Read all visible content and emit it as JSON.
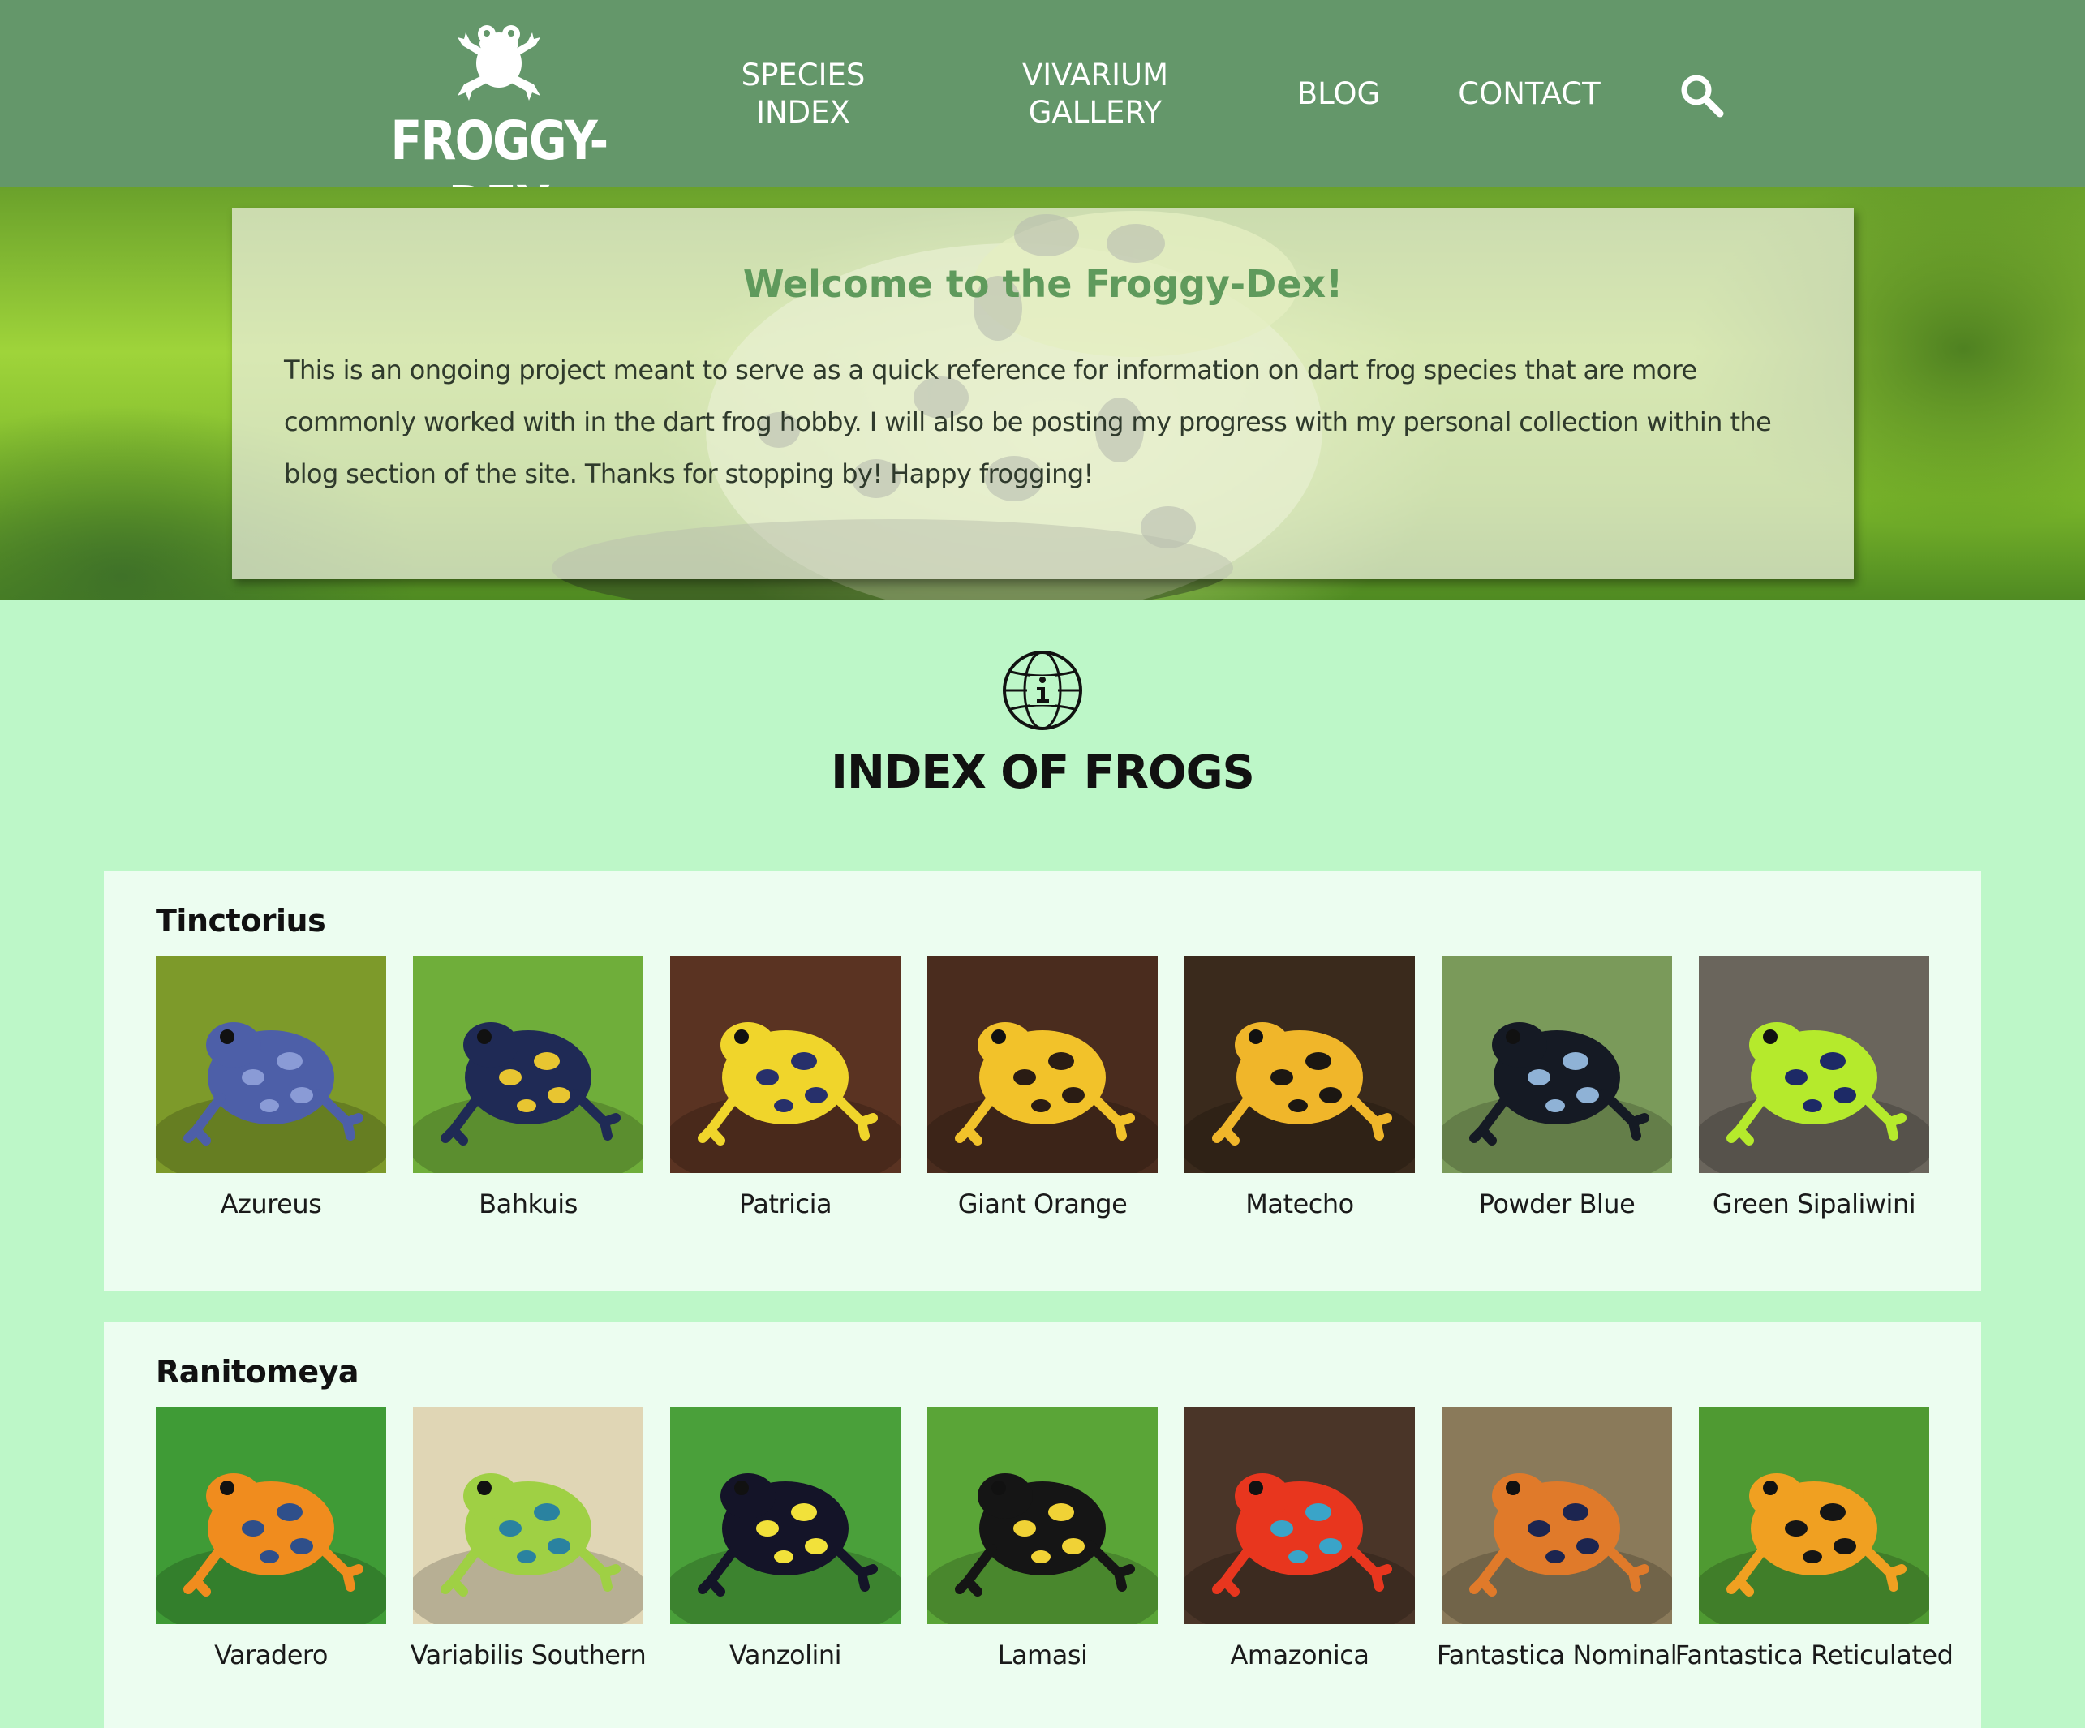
{
  "brand": {
    "name": "FROGGY-DEX",
    "icon": "frog-logo-icon"
  },
  "nav": {
    "items": [
      {
        "label": "SPECIES\nINDEX"
      },
      {
        "label": "VIVARIUM\nGALLERY"
      },
      {
        "label": "BLOG"
      },
      {
        "label": "CONTACT"
      }
    ],
    "search_icon": "magnifier-icon"
  },
  "welcome": {
    "title": "Welcome to the Froggy-Dex!",
    "body": "This is an ongoing project meant to serve as a quick reference for information on dart frog species that are more commonly worked with in the dart frog hobby. I will also be posting my progress with my personal collection within the blog section of the site. Thanks for stopping by! Happy frogging!"
  },
  "index": {
    "icon": "globe-info-icon",
    "title": "INDEX OF FROGS"
  },
  "groups": [
    {
      "name": "Tinctorius",
      "frogs": [
        {
          "name": "Azureus",
          "colors": [
            "#4d5fa8",
            "#8a9bd6"
          ],
          "bg": "#7d9a2a"
        },
        {
          "name": "Bahkuis",
          "colors": [
            "#1f2a55",
            "#e8c531"
          ],
          "bg": "#6fae3a"
        },
        {
          "name": "Patricia",
          "colors": [
            "#f0d52b",
            "#27306b"
          ],
          "bg": "#5a3322"
        },
        {
          "name": "Giant Orange",
          "colors": [
            "#f2c22a",
            "#2a1c14"
          ],
          "bg": "#4a2c1e"
        },
        {
          "name": "Matecho",
          "colors": [
            "#f0b62a",
            "#1c1712"
          ],
          "bg": "#3a2a1c"
        },
        {
          "name": "Powder Blue",
          "colors": [
            "#151a24",
            "#8fb2d6"
          ],
          "bg": "#7a9a5a"
        },
        {
          "name": "Green Sipaliwini",
          "colors": [
            "#b5ea2c",
            "#1d2a66"
          ],
          "bg": "#6a655c"
        }
      ]
    },
    {
      "name": "Ranitomeya",
      "frogs": [
        {
          "name": "Varadero",
          "colors": [
            "#f08c1e",
            "#2f4f8a"
          ],
          "bg": "#3f9b36"
        },
        {
          "name": "Variabilis Southern",
          "colors": [
            "#9fd044",
            "#2a82a0"
          ],
          "bg": "#e0d6b5"
        },
        {
          "name": "Vanzolini",
          "colors": [
            "#141428",
            "#f2e13a"
          ],
          "bg": "#4aa03a"
        },
        {
          "name": "Lamasi",
          "colors": [
            "#151515",
            "#f0d236"
          ],
          "bg": "#5aa537"
        },
        {
          "name": "Amazonica",
          "colors": [
            "#e8361e",
            "#3aa4c8"
          ],
          "bg": "#4a3528"
        },
        {
          "name": "Fantastica Nominal",
          "colors": [
            "#e07a2a",
            "#1c2550"
          ],
          "bg": "#8a7a5a"
        },
        {
          "name": "Fantastica\nReticulated",
          "colors": [
            "#f0a021",
            "#151515"
          ],
          "bg": "#4f9a32"
        }
      ]
    }
  ]
}
